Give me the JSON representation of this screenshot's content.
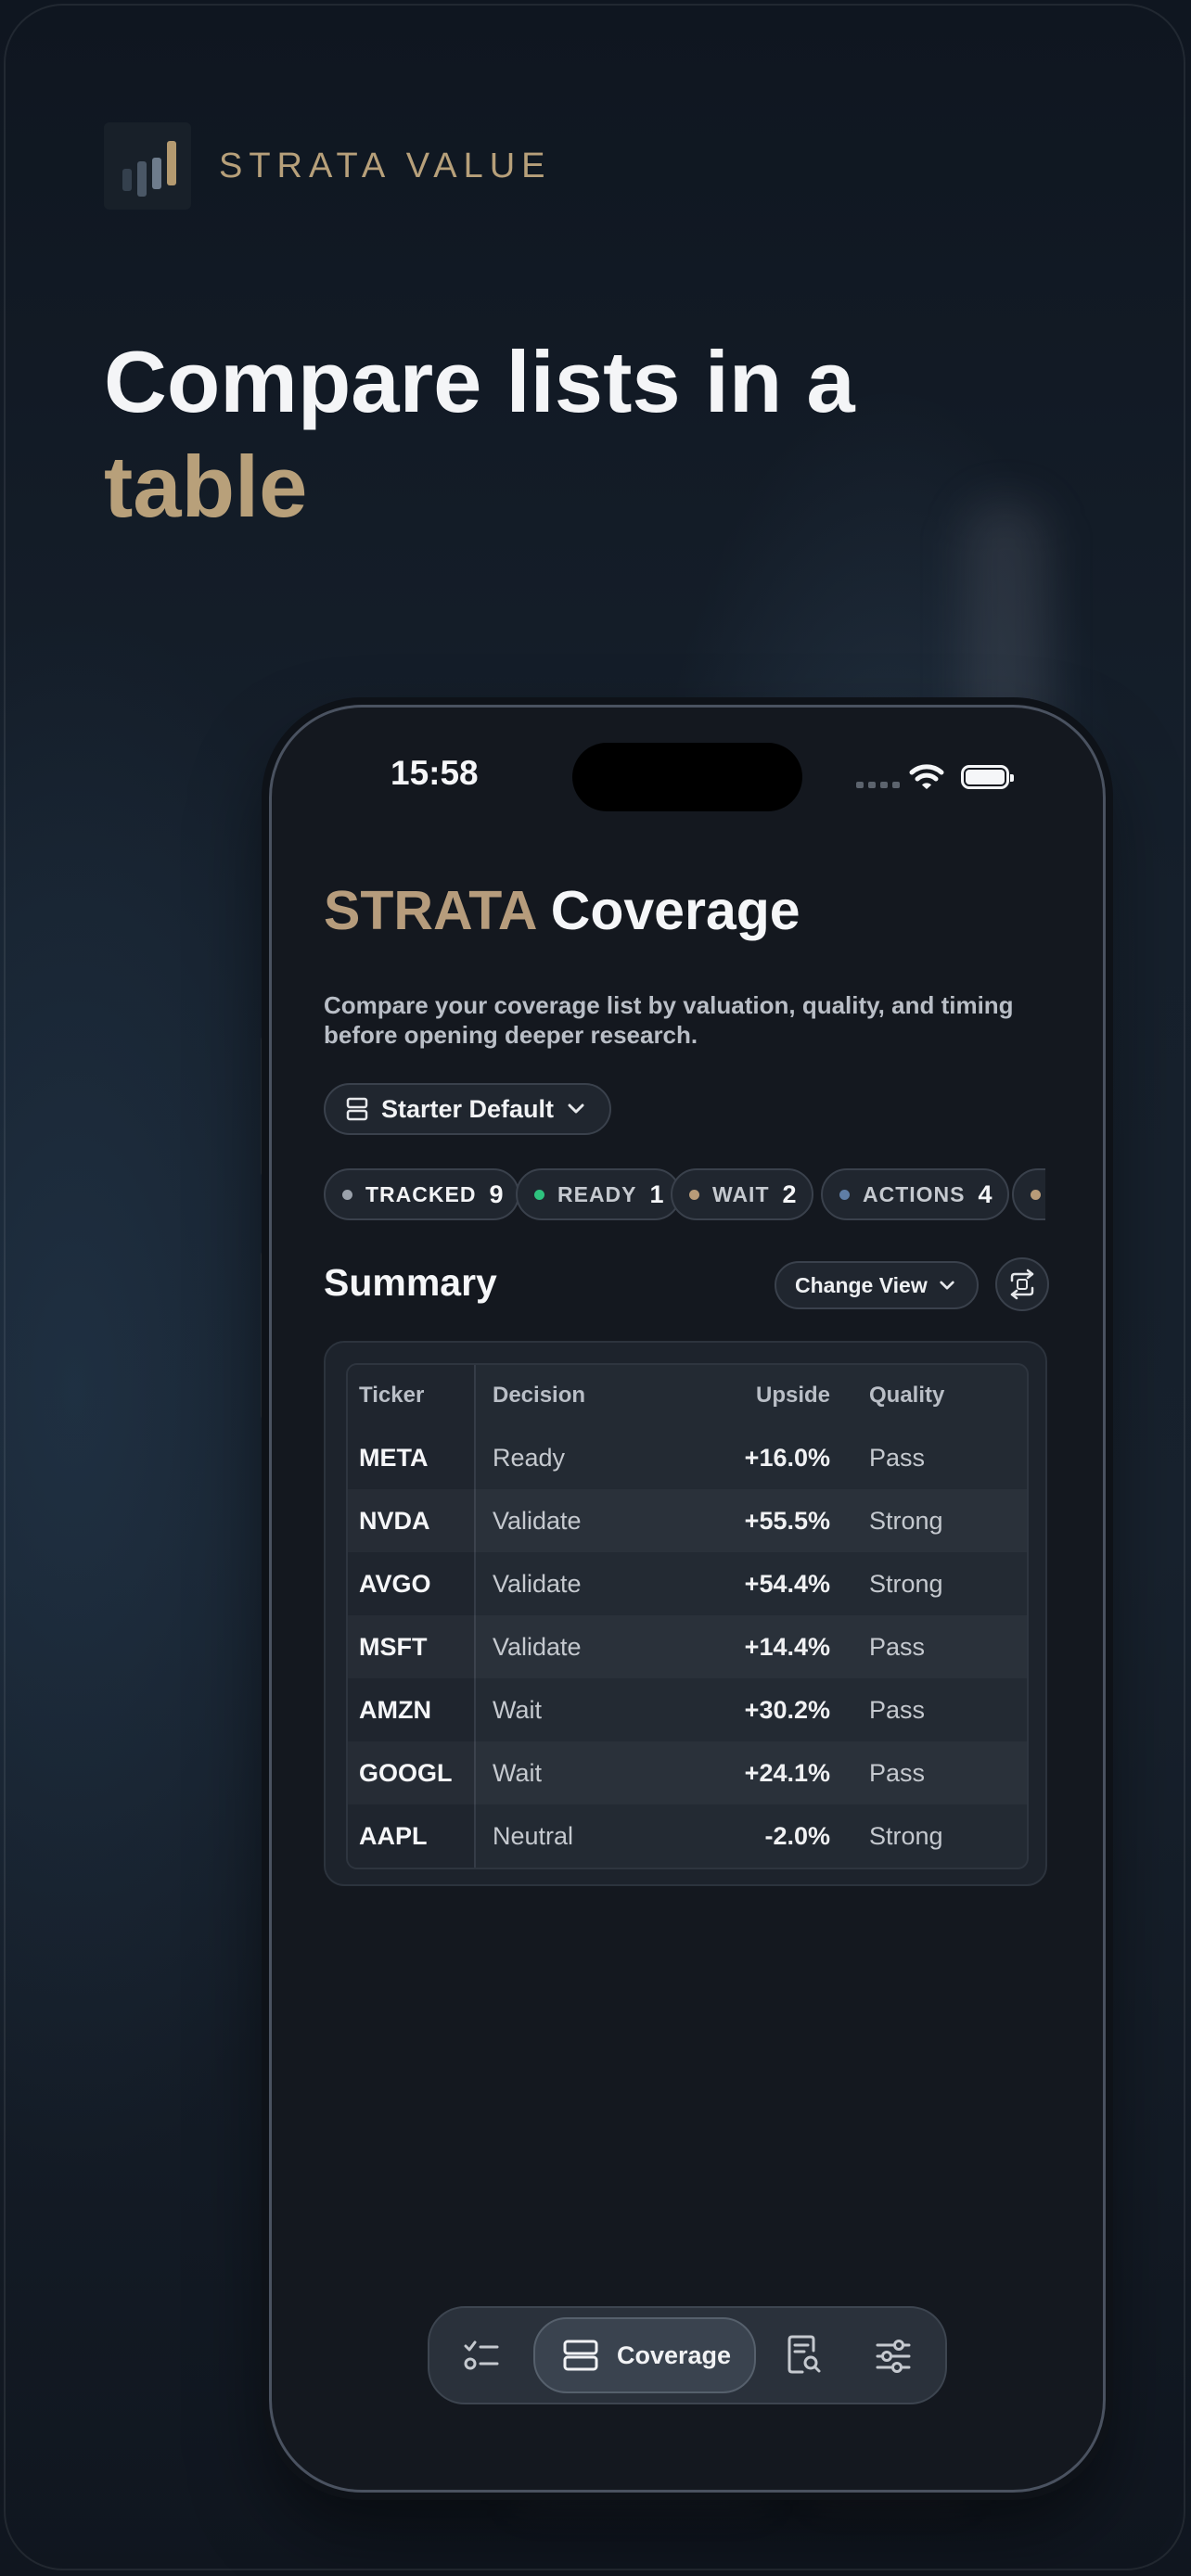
{
  "brand": {
    "name": "STRATA VALUE"
  },
  "headline": {
    "line1": "Compare lists in a",
    "line2": "table"
  },
  "status_bar": {
    "time": "15:58"
  },
  "screen": {
    "title_accent": "STRATA",
    "title_rest": "Coverage",
    "subtitle": "Compare your coverage list by valuation, quality, and timing before opening deeper research.",
    "preset": {
      "label": "Starter Default"
    },
    "chips": [
      {
        "label": "TRACKED",
        "count": "9",
        "color": "#9aa1ab"
      },
      {
        "label": "READY",
        "count": "1",
        "color": "#2ec27e"
      },
      {
        "label": "WAIT",
        "count": "2",
        "color": "#b89b78"
      },
      {
        "label": "ACTIONS",
        "count": "4",
        "color": "#5f7ea6"
      }
    ],
    "summary_title": "Summary",
    "change_view": "Change View",
    "table": {
      "headers": {
        "ticker": "Ticker",
        "decision": "Decision",
        "upside": "Upside",
        "quality": "Quality"
      },
      "rows": [
        {
          "ticker": "META",
          "decision": "Ready",
          "upside": "+16.0%",
          "quality": "Pass"
        },
        {
          "ticker": "NVDA",
          "decision": "Validate",
          "upside": "+55.5%",
          "quality": "Strong"
        },
        {
          "ticker": "AVGO",
          "decision": "Validate",
          "upside": "+54.4%",
          "quality": "Strong"
        },
        {
          "ticker": "MSFT",
          "decision": "Validate",
          "upside": "+14.4%",
          "quality": "Pass"
        },
        {
          "ticker": "AMZN",
          "decision": "Wait",
          "upside": "+30.2%",
          "quality": "Pass"
        },
        {
          "ticker": "GOOGL",
          "decision": "Wait",
          "upside": "+24.1%",
          "quality": "Pass"
        },
        {
          "ticker": "AAPL",
          "decision": "Neutral",
          "upside": "-2.0%",
          "quality": "Strong"
        }
      ]
    },
    "tabbar": {
      "active_label": "Coverage",
      "tabs": [
        "checklist-icon",
        "coverage-icon",
        "research-icon",
        "settings-sliders-icon"
      ]
    }
  },
  "colors": {
    "accent": "#b8a07a",
    "background": "#0e141c",
    "ready": "#2ec27e"
  }
}
